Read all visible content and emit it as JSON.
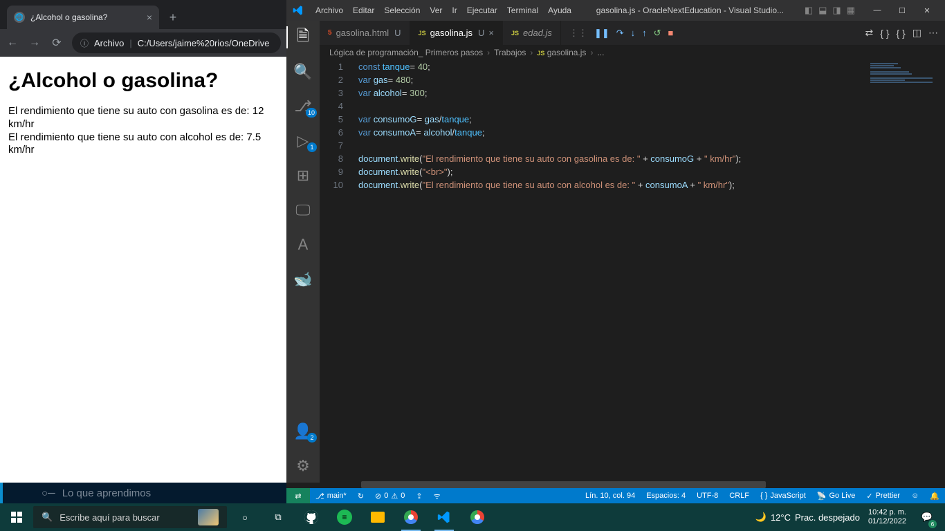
{
  "browser": {
    "tab_title": "¿Alcohol o gasolina?",
    "omnibox_prefix": "Archivo",
    "omnibox_path": "C:/Users/jaime%20rios/OneDrive",
    "page_heading": "¿Alcohol o gasolina?",
    "page_line1": "El rendimiento que tiene su auto con gasolina es de: 12 km/hr",
    "page_line2": "El rendimiento que tiene su auto con alcohol es de: 7.5 km/hr",
    "alura_text": "Lo que aprendimos"
  },
  "vscode": {
    "menus": [
      "Archivo",
      "Editar",
      "Selección",
      "Ver",
      "Ir",
      "Ejecutar",
      "Terminal",
      "Ayuda"
    ],
    "window_title": "gasolina.js - OracleNextEducation - Visual Studio...",
    "tabs": [
      {
        "icon": "html5",
        "label": "gasolina.html",
        "status": "U",
        "active": false
      },
      {
        "icon": "js",
        "label": "gasolina.js",
        "status": "U",
        "active": true
      },
      {
        "icon": "js",
        "label": "edad.js",
        "status": "",
        "active": false,
        "italic": true
      }
    ],
    "breadcrumbs": [
      "Lógica de programación_ Primeros pasos",
      "Trabajos",
      "gasolina.js",
      "..."
    ],
    "badge_scm": "10",
    "badge_debug": "1",
    "badge_account": "2",
    "status": {
      "branch": "main*",
      "sync": "↻",
      "errors": "0",
      "warnings": "0",
      "cursor": "Lín. 10, col. 94",
      "spaces": "Espacios: 4",
      "encoding": "UTF-8",
      "eol": "CRLF",
      "lang": "JavaScript",
      "golive": "Go Live",
      "prettier": "Prettier"
    },
    "code_lines": [
      {
        "n": 1,
        "html": "<span class='kw'>const</span> <span class='obj'>tanque</span>= <span class='num'>40</span>;"
      },
      {
        "n": 2,
        "html": "<span class='kw'>var</span> <span class='var'>gas</span>= <span class='num'>480</span>;"
      },
      {
        "n": 3,
        "html": "<span class='kw'>var</span> <span class='var'>alcohol</span>= <span class='num'>300</span>;"
      },
      {
        "n": 4,
        "html": ""
      },
      {
        "n": 5,
        "html": "<span class='kw'>var</span> <span class='var'>consumoG</span>= <span class='var'>gas</span>/<span class='obj'>tanque</span>;"
      },
      {
        "n": 6,
        "html": "<span class='kw'>var</span> <span class='var'>consumoA</span>= <span class='var'>alcohol</span>/<span class='obj'>tanque</span>;"
      },
      {
        "n": 7,
        "html": ""
      },
      {
        "n": 8,
        "html": "<span class='var'>document</span>.<span class='fn'>write</span>(<span class='str'>\"El rendimiento que tiene su auto con gasolina es de: \"</span> + <span class='var'>consumoG</span> + <span class='str'>\" km/hr\"</span>);"
      },
      {
        "n": 9,
        "html": "<span class='var'>document</span>.<span class='fn'>write</span>(<span class='str'>\"&lt;br&gt;\"</span>);"
      },
      {
        "n": 10,
        "html": "<span class='var'>document</span>.<span class='fn'>write</span>(<span class='str'>\"El rendimiento que tiene su auto con alcohol es de: \"</span> + <span class='var'>consumoA</span> + <span class='str'>\" km/hr\"</span>);"
      }
    ]
  },
  "taskbar": {
    "search_placeholder": "Escribe aquí para buscar",
    "weather_temp": "12°C",
    "weather_desc": "Prac. despejado",
    "time": "10:42 p. m.",
    "date": "01/12/2022",
    "notif_count": "6"
  }
}
